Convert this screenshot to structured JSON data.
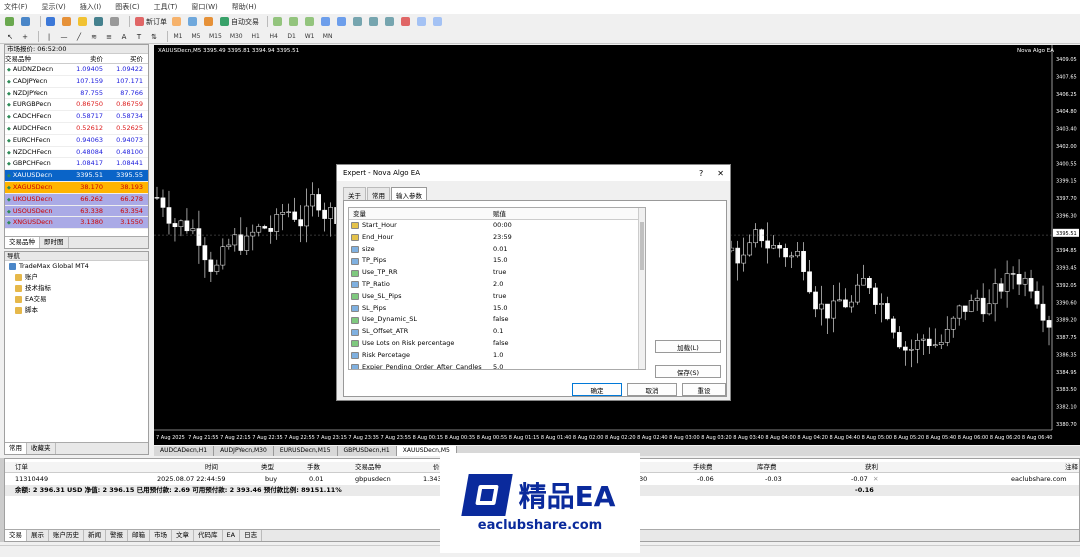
{
  "menu": [
    "文件(F)",
    "显示(V)",
    "插入(I)",
    "图表(C)",
    "工具(T)",
    "窗口(W)",
    "帮助(H)"
  ],
  "toolbar": {
    "new_order": "新订单",
    "auto_trading": "自动交易",
    "timeframes": [
      "M1",
      "M5",
      "M15",
      "M30",
      "H1",
      "H4",
      "D1",
      "W1",
      "MN"
    ]
  },
  "market_watch": {
    "title": "市场报价: 06:52:00",
    "headers": [
      "交易品种",
      "卖价",
      "买价"
    ],
    "rows": [
      {
        "symbol": "AUDNZDecn",
        "bid": "1.09405",
        "ask": "1.09422",
        "color": "blue"
      },
      {
        "symbol": "CADJPYecn",
        "bid": "107.159",
        "ask": "107.171",
        "color": "blue"
      },
      {
        "symbol": "NZDJPYecn",
        "bid": "87.755",
        "ask": "87.766",
        "color": "blue"
      },
      {
        "symbol": "EURGBPecn",
        "bid": "0.86750",
        "ask": "0.86759",
        "color": "red"
      },
      {
        "symbol": "CADCHFecn",
        "bid": "0.58717",
        "ask": "0.58734",
        "color": "blue"
      },
      {
        "symbol": "AUDCHFecn",
        "bid": "0.52612",
        "ask": "0.52625",
        "color": "red"
      },
      {
        "symbol": "EURCHFecn",
        "bid": "0.94063",
        "ask": "0.94073",
        "color": "blue"
      },
      {
        "symbol": "NZDCHFecn",
        "bid": "0.48084",
        "ask": "0.48100",
        "color": "blue"
      },
      {
        "symbol": "GBPCHFecn",
        "bid": "1.08417",
        "ask": "1.08441",
        "color": "blue"
      },
      {
        "symbol": "XAUUSDecn",
        "bid": "3395.51",
        "ask": "3395.55",
        "color": "sel-blue"
      },
      {
        "symbol": "XAGUSDecn",
        "bid": "38.170",
        "ask": "38.193",
        "color": "sel-orange"
      },
      {
        "symbol": "UKOUSDecn",
        "bid": "66.262",
        "ask": "66.278",
        "color": "sel-purple"
      },
      {
        "symbol": "USOUSDecn",
        "bid": "63.338",
        "ask": "63.354",
        "color": "sel-purple"
      },
      {
        "symbol": "XNGUSDecn",
        "bid": "3.1380",
        "ask": "3.1550",
        "color": "sel-purple"
      }
    ],
    "tabs": [
      "交易品种",
      "即时图"
    ]
  },
  "navigator": {
    "title": "导航",
    "root": "TradeMax Global MT4",
    "items": [
      "账户",
      "技术指标",
      "EA交易",
      "脚本"
    ],
    "tabs": [
      "常用",
      "收藏夹"
    ]
  },
  "chart": {
    "info": "XAUUSDecn,M5  3395.49 3395.81 3394.94 3395.51",
    "ea_name": "Nova Algo EA",
    "price_labels": [
      "3409.05",
      "3407.65",
      "3406.25",
      "3404.80",
      "3403.40",
      "3402.00",
      "3400.55",
      "3399.15",
      "3397.70",
      "3396.30",
      "3395.51",
      "3394.85",
      "3393.45",
      "3392.05",
      "3390.60",
      "3389.20",
      "3387.75",
      "3386.35",
      "3384.95",
      "3383.50",
      "3382.10",
      "3380.70"
    ],
    "time_labels": [
      "7 Aug 2025",
      "7 Aug 21:55",
      "7 Aug 22:15",
      "7 Aug 22:35",
      "7 Aug 22:55",
      "7 Aug 23:15",
      "7 Aug 23:35",
      "7 Aug 23:55",
      "8 Aug 00:15",
      "8 Aug 00:35",
      "8 Aug 00:55",
      "8 Aug 01:15",
      "8 Aug 01:40",
      "8 Aug 02:00",
      "8 Aug 02:20",
      "8 Aug 02:40",
      "8 Aug 03:00",
      "8 Aug 03:20",
      "8 Aug 03:40",
      "8 Aug 04:00",
      "8 Aug 04:20",
      "8 Aug 04:40",
      "8 Aug 05:00",
      "8 Aug 05:20",
      "8 Aug 05:40",
      "8 Aug 06:00",
      "8 Aug 06:20",
      "8 Aug 06:40"
    ],
    "tabs": [
      "AUDCADecn,H1",
      "AUDJPYecn,M30",
      "EURUSDecn,M15",
      "GBPUSDecn,H1",
      "XAUUSDecn,M5"
    ]
  },
  "dialog": {
    "title": "Expert - Nova Algo EA",
    "help": "?",
    "close": "✕",
    "tabs": [
      "关于",
      "常用",
      "输入参数"
    ],
    "grid_headers": [
      "变量",
      "赋值"
    ],
    "params": [
      {
        "name": "Start_Hour",
        "value": "00:00",
        "type": "ab"
      },
      {
        "name": "End_Hour",
        "value": "23:59",
        "type": "ab"
      },
      {
        "name": "size",
        "value": "0.01",
        "type": "num"
      },
      {
        "name": "TP_Pips",
        "value": "15.0",
        "type": "num"
      },
      {
        "name": "Use_TP_RR",
        "value": "true",
        "type": "bool"
      },
      {
        "name": "TP_Ratio",
        "value": "2.0",
        "type": "num"
      },
      {
        "name": "Use_SL_Pips",
        "value": "true",
        "type": "bool"
      },
      {
        "name": "SL_Pips",
        "value": "15.0",
        "type": "num"
      },
      {
        "name": "Use_Dynamic_SL",
        "value": "false",
        "type": "bool"
      },
      {
        "name": "SL_Offset_ATR",
        "value": "0.1",
        "type": "num"
      },
      {
        "name": "Use Lots on Risk percentage",
        "value": "false",
        "type": "bool"
      },
      {
        "name": "Risk Percetage",
        "value": "1.0",
        "type": "num"
      },
      {
        "name": "Expier_Pending_Order_After_Candles",
        "value": "5.0",
        "type": "num"
      }
    ],
    "load_button": "加载(L)",
    "save_button": "保存(S)",
    "ok_button": "确定",
    "cancel_button": "取消",
    "reset_button": "重设"
  },
  "terminal": {
    "headers": {
      "order": "订单",
      "time": "时间",
      "type": "类型",
      "lots": "手数",
      "symbol": "交易品种",
      "price": "价",
      "commission": "手续费",
      "swap": "库存费",
      "profit": "获利",
      "comment": "注释"
    },
    "row": {
      "order": "11310449",
      "time": "2025.08.07 22:44:59",
      "type": "buy",
      "lots": "0.01",
      "symbol": "gbpusdecn",
      "price": "1.343",
      "price_tail": "30",
      "commission": "-0.06",
      "swap": "-0.03",
      "profit": "-0.07",
      "comment": "eaclubshare.com"
    },
    "balance": "余额: 2 396.31 USD  净值: 2 396.15  已用预付款: 2.69  可用预付款: 2 393.46  预付款比例: 89151.11%",
    "balance_profit": "-0.16",
    "tabs": [
      "交易",
      "展示",
      "账户历史",
      "新闻",
      "警报",
      "邮箱",
      "市场",
      "文章",
      "代码库",
      "EA",
      "日志"
    ]
  },
  "watermark": {
    "title": "精品EA",
    "url": "eaclubshare.com"
  }
}
